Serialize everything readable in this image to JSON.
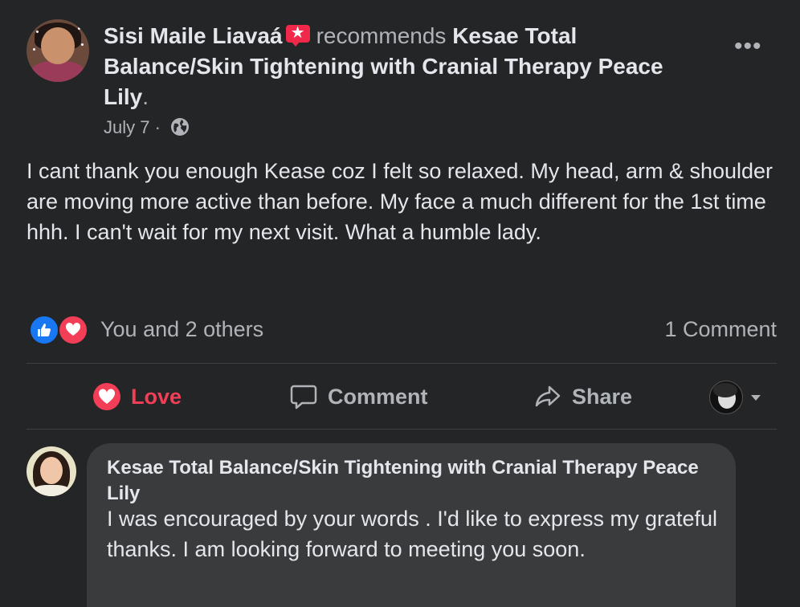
{
  "post": {
    "author": "Sisi Maile Liavaá",
    "action_text": "recommends",
    "page_name": "Kesae Total Balance/Skin Tightening with Cranial Therapy Peace Lily",
    "page_suffix": ".",
    "date": "July 7",
    "separator": "·",
    "privacy_icon": "globe-icon",
    "more_label": "•••",
    "body": "I cant thank you enough Kease coz I felt so relaxed. My head, arm & shoulder are moving more active than before. My face a much different for the 1st time hhh. I can't wait for my next visit. What a humble lady.",
    "reactions_text": "You and 2 others",
    "reaction_icons": [
      "like-icon",
      "love-icon"
    ],
    "comment_count": "1 Comment"
  },
  "actions": {
    "love": "Love",
    "comment": "Comment",
    "share": "Share"
  },
  "comment": {
    "author": "Kesae Total Balance/Skin Tightening with Cranial Therapy Peace Lily",
    "text": "I was encouraged by your words . I'd like to express my grateful thanks. I am looking forward to meeting you soon."
  },
  "colors": {
    "background": "#242526",
    "bubble": "#3a3b3c",
    "love_red": "#f33e58",
    "like_blue": "#1877f2",
    "recommend_badge": "#f02849",
    "muted_text": "#b0b3b8"
  }
}
